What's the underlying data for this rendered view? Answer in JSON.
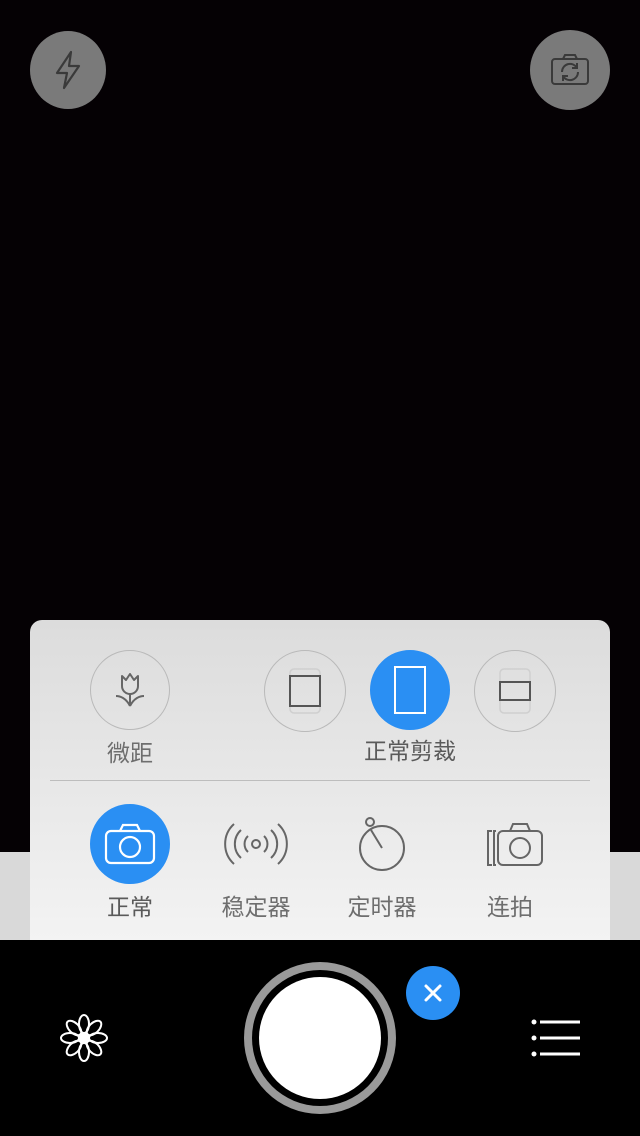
{
  "top_controls": {
    "flash_icon": "flash-icon",
    "switch_camera_icon": "switch-camera-icon"
  },
  "panel": {
    "macro": {
      "label": "微距",
      "icon": "macro-flower-icon"
    },
    "crop": {
      "label": "正常剪裁",
      "options": [
        {
          "icon": "crop-square-icon",
          "selected": false
        },
        {
          "icon": "crop-portrait-icon",
          "selected": true
        },
        {
          "icon": "crop-widescreen-icon",
          "selected": false
        }
      ]
    },
    "modes": [
      {
        "label": "正常",
        "icon": "camera-icon",
        "selected": true
      },
      {
        "label": "稳定器",
        "icon": "stabilizer-icon",
        "selected": false
      },
      {
        "label": "定时器",
        "icon": "timer-icon",
        "selected": false
      },
      {
        "label": "连拍",
        "icon": "burst-icon",
        "selected": false
      }
    ]
  },
  "bottom_bar": {
    "filter_icon": "flower-icon",
    "shutter": "shutter-button",
    "close_icon": "close-icon",
    "menu_icon": "menu-icon"
  },
  "colors": {
    "accent": "#2a8ff3",
    "panel_bg": "#e6e6e6",
    "label_text": "#6e6e6e",
    "top_button_bg": "#7a7a7a"
  }
}
